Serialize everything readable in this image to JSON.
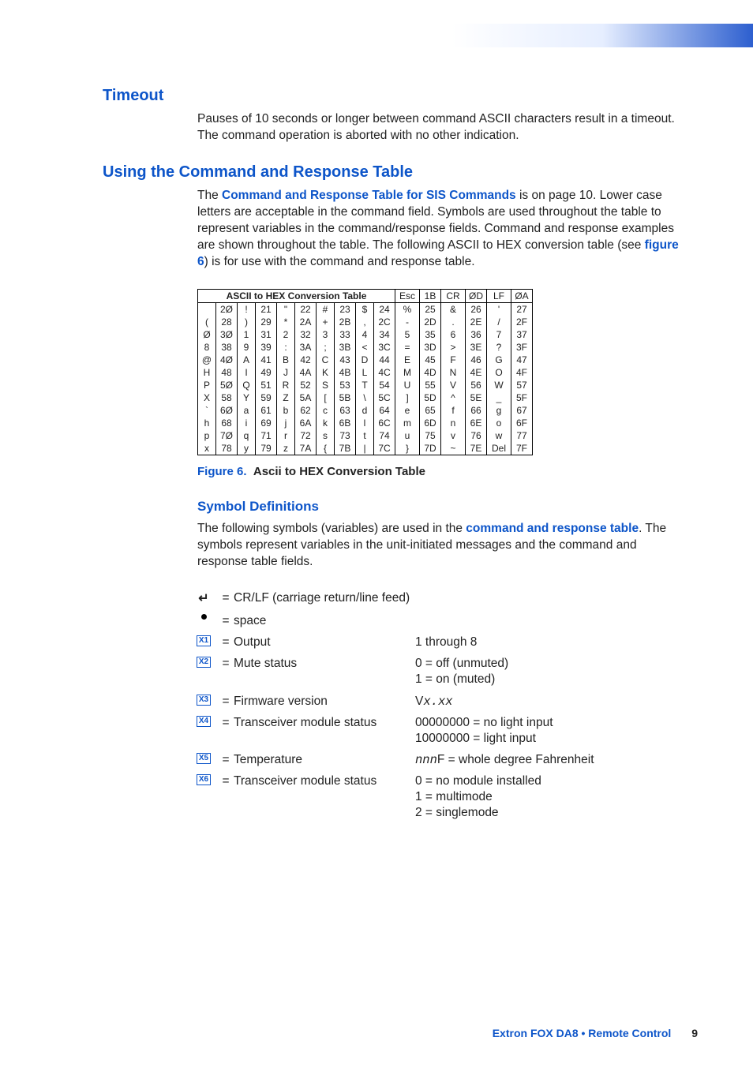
{
  "sections": {
    "timeout": {
      "heading": "Timeout",
      "text": "Pauses of 10 seconds or longer between command ASCII characters result in a timeout. The command operation is aborted with no other indication."
    },
    "using": {
      "heading": "Using the Command and Response Table",
      "text_pre": "The ",
      "link1": "Command and Response Table for SIS Commands",
      "text_mid": " is on page 10. Lower case letters are acceptable in the command field. Symbols are used throughout the table to represent variables in the command/response fields. Command and response examples are shown throughout the table. The following ASCII to HEX conversion table (see ",
      "link2": "figure 6",
      "text_post": ") is for use with the command and response table."
    },
    "symbol": {
      "heading": "Symbol Definitions",
      "text_pre": "The following symbols (variables) are used in the ",
      "link": "command and response table",
      "text_post": ". The symbols represent variables in the unit-initiated messages and the command and response table fields."
    }
  },
  "figure": {
    "num": "Figure 6.",
    "title": "Ascii to HEX Conversion Table"
  },
  "conv_table": {
    "title": "ASCII to HEX  Conversion Table",
    "header_extra": [
      [
        "Esc",
        "1B"
      ],
      [
        "CR",
        "ØD"
      ],
      [
        "LF",
        "ØA"
      ]
    ],
    "rows": [
      [
        [
          "",
          "2Ø"
        ],
        [
          "!",
          "21"
        ],
        [
          "\"",
          "22"
        ],
        [
          "#",
          "23"
        ],
        [
          "$",
          "24"
        ],
        [
          "%",
          "25"
        ],
        [
          "&",
          "26"
        ],
        [
          "'",
          "27"
        ]
      ],
      [
        [
          "(",
          "28"
        ],
        [
          ")",
          "29"
        ],
        [
          "*",
          "2A"
        ],
        [
          "+",
          "2B"
        ],
        [
          ",",
          "2C"
        ],
        [
          "-",
          "2D"
        ],
        [
          ".",
          "2E"
        ],
        [
          "/",
          "2F"
        ]
      ],
      [
        [
          "Ø",
          "3Ø"
        ],
        [
          "1",
          "31"
        ],
        [
          "2",
          "32"
        ],
        [
          "3",
          "33"
        ],
        [
          "4",
          "34"
        ],
        [
          "5",
          "35"
        ],
        [
          "6",
          "36"
        ],
        [
          "7",
          "37"
        ]
      ],
      [
        [
          "8",
          "38"
        ],
        [
          "9",
          "39"
        ],
        [
          ":",
          "3A"
        ],
        [
          ";",
          "3B"
        ],
        [
          "<",
          "3C"
        ],
        [
          "=",
          "3D"
        ],
        [
          ">",
          "3E"
        ],
        [
          "?",
          "3F"
        ]
      ],
      [
        [
          "@",
          "4Ø"
        ],
        [
          "A",
          "41"
        ],
        [
          "B",
          "42"
        ],
        [
          "C",
          "43"
        ],
        [
          "D",
          "44"
        ],
        [
          "E",
          "45"
        ],
        [
          "F",
          "46"
        ],
        [
          "G",
          "47"
        ]
      ],
      [
        [
          "H",
          "48"
        ],
        [
          "I",
          "49"
        ],
        [
          "J",
          "4A"
        ],
        [
          "K",
          "4B"
        ],
        [
          "L",
          "4C"
        ],
        [
          "M",
          "4D"
        ],
        [
          "N",
          "4E"
        ],
        [
          "O",
          "4F"
        ]
      ],
      [
        [
          "P",
          "5Ø"
        ],
        [
          "Q",
          "51"
        ],
        [
          "R",
          "52"
        ],
        [
          "S",
          "53"
        ],
        [
          "T",
          "54"
        ],
        [
          "U",
          "55"
        ],
        [
          "V",
          "56"
        ],
        [
          "W",
          "57"
        ]
      ],
      [
        [
          "X",
          "58"
        ],
        [
          "Y",
          "59"
        ],
        [
          "Z",
          "5A"
        ],
        [
          "[",
          "5B"
        ],
        [
          "\\",
          "5C"
        ],
        [
          "]",
          "5D"
        ],
        [
          "^",
          "5E"
        ],
        [
          "_",
          "5F"
        ]
      ],
      [
        [
          "`",
          "6Ø"
        ],
        [
          "a",
          "61"
        ],
        [
          "b",
          "62"
        ],
        [
          "c",
          "63"
        ],
        [
          "d",
          "64"
        ],
        [
          "e",
          "65"
        ],
        [
          "f",
          "66"
        ],
        [
          "g",
          "67"
        ]
      ],
      [
        [
          "h",
          "68"
        ],
        [
          "i",
          "69"
        ],
        [
          "j",
          "6A"
        ],
        [
          "k",
          "6B"
        ],
        [
          "l",
          "6C"
        ],
        [
          "m",
          "6D"
        ],
        [
          "n",
          "6E"
        ],
        [
          "o",
          "6F"
        ]
      ],
      [
        [
          "p",
          "7Ø"
        ],
        [
          "q",
          "71"
        ],
        [
          "r",
          "72"
        ],
        [
          "s",
          "73"
        ],
        [
          "t",
          "74"
        ],
        [
          "u",
          "75"
        ],
        [
          "v",
          "76"
        ],
        [
          "w",
          "77"
        ]
      ],
      [
        [
          "x",
          "78"
        ],
        [
          "y",
          "79"
        ],
        [
          "z",
          "7A"
        ],
        [
          "{",
          "7B"
        ],
        [
          "|",
          "7C"
        ],
        [
          "}",
          "7D"
        ],
        [
          "~",
          "7E"
        ],
        [
          "Del",
          "7F"
        ]
      ]
    ]
  },
  "symbols": [
    {
      "icon": "crlf",
      "eq": "=",
      "desc": "CR/LF (carriage return/line feed)",
      "val": ""
    },
    {
      "icon": "bullet",
      "eq": "=",
      "desc": "space",
      "val": ""
    },
    {
      "icon": "X1",
      "eq": "=",
      "desc": "Output",
      "val": "1 through 8"
    },
    {
      "icon": "X2",
      "eq": "=",
      "desc": "Mute status",
      "val": "0 = off (unmuted)\n1 = on (muted)"
    },
    {
      "icon": "X3",
      "eq": "=",
      "desc": "Firmware version",
      "val_mono": "Vx.xx"
    },
    {
      "icon": "X4",
      "eq": "=",
      "desc": "Transceiver module status",
      "val": "00000000 = no light input\n10000000 = light input"
    },
    {
      "icon": "X5",
      "eq": "=",
      "desc": "Temperature",
      "val_html": "<span class='mono-i'>nnn</span>F = whole degree Fahrenheit"
    },
    {
      "icon": "X6",
      "eq": "=",
      "desc": "Transceiver module status",
      "val": "0 = no module installed\n1 = multimode\n2 = singlemode"
    }
  ],
  "footer": {
    "doc": "Extron FOX DA8 • Remote Control",
    "page": "9"
  }
}
